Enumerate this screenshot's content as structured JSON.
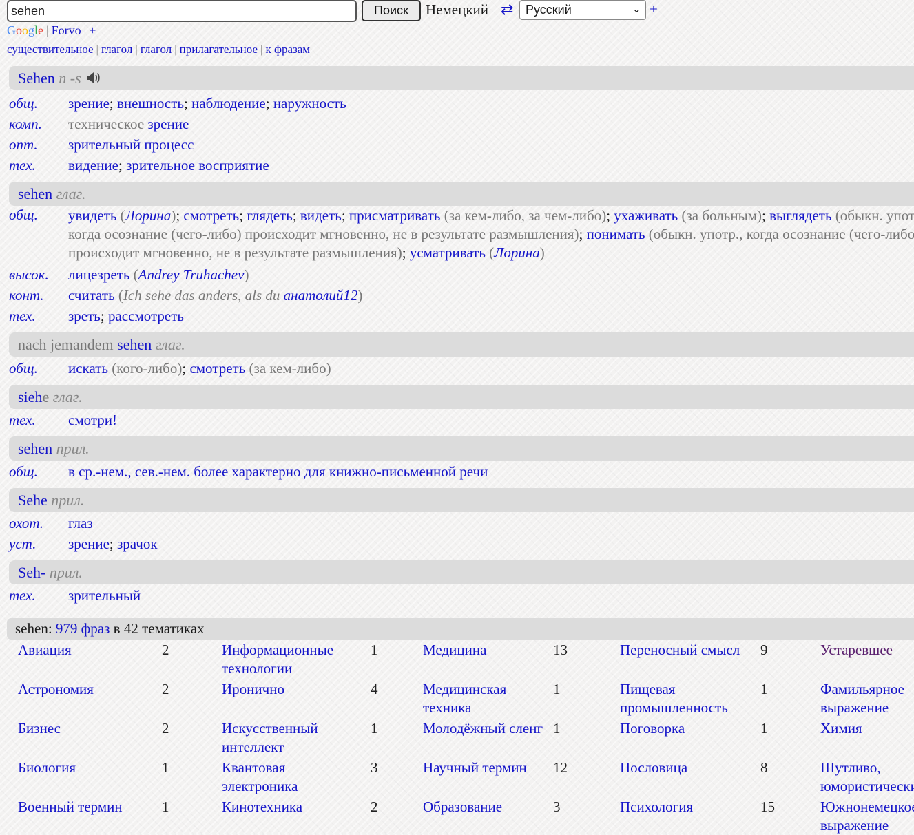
{
  "search": {
    "value": "sehen",
    "button_label": "Поиск"
  },
  "lang": {
    "source": "Немецкий",
    "swap_glyph": "⇄",
    "target": "Русский",
    "add": "+"
  },
  "top_links": {
    "google": [
      "G",
      "o",
      "o",
      "g",
      "l",
      "e"
    ],
    "forvo": "Forvo",
    "plus": "+"
  },
  "pos_links": [
    "существительное",
    "глагол",
    "глагол",
    "прилагательное",
    "к фразам"
  ],
  "entries": [
    {
      "word": "Sehen",
      "gram": "n -s",
      "has_audio": true,
      "rows": [
        {
          "subj": "общ.",
          "html": "a:зрение|; |a:внешность|; |a:наблюдение|; |a:наружность"
        },
        {
          "subj": "комп.",
          "html": "g:техническое |a:зрение"
        },
        {
          "subj": "опт.",
          "html": "a:зрительный процесс"
        },
        {
          "subj": "тех.",
          "html": "a:видение|; |a:зрительное восприятие"
        }
      ]
    },
    {
      "word": "sehen",
      "gram": "глаг.",
      "rows": [
        {
          "subj": "общ.",
          "wrap": true,
          "html": "a:увидеть| |g:(|ai:Лорина|g:)|; |a:смотреть|; |a:глядеть|; |a:видеть|; |a:присматривать| |g:(за кем-либо, за чем-либо)|; |a:ухаживать| |g:(за больным)|; |a:выглядеть| |g:(обыкн. употр., когда осознание (чего-либо) происходит мгновенно, не в результате размышления)|; |a:понимать| |g:(обыкн. употр., когда осознание (чего-либо) происходит мгновенно, не в результате размышления)|; |a:усматривать| |g:(|ai:Лорина|g:)"
        },
        {
          "subj": "высок.",
          "html": "a:лицезреть| |g:(|ai:Andrey Truhachev|g:)"
        },
        {
          "subj": "конт.",
          "html": "a:считать| |g:(|gi:Ich sehe das anders, als du |ai:анатолий12|g:)"
        },
        {
          "subj": "тех.",
          "html": "a:зреть|; |a:рассмотреть"
        }
      ]
    },
    {
      "word_parts": [
        [
          "g",
          "nach jemandem "
        ],
        [
          "a",
          "sehen"
        ]
      ],
      "gram": "глаг.",
      "rows": [
        {
          "subj": "общ.",
          "html": "a:искать| |g:(кого-либо)|; |a:смотреть| |g:(за кем-либо)"
        }
      ]
    },
    {
      "word_parts": [
        [
          "a",
          "sieh"
        ],
        [
          "g",
          "e"
        ]
      ],
      "gram": "глаг.",
      "rows": [
        {
          "subj": "тех.",
          "html": "a:смотри!"
        }
      ]
    },
    {
      "word": "sehen",
      "gram": "прил.",
      "rows": [
        {
          "subj": "общ.",
          "html": "a:в ср.-нем., сев.-нем. более характерно для книжно-письменной речи"
        }
      ]
    },
    {
      "word": "Sehe",
      "gram": "прил.",
      "rows": [
        {
          "subj": "охот.",
          "html": "a:глаз"
        },
        {
          "subj": "уст.",
          "html": "a:зрение|; |a:зрачок"
        }
      ]
    },
    {
      "word": "Seh-",
      "gram": "прил.",
      "rows": [
        {
          "subj": "тех.",
          "html": "a:зрительный"
        }
      ]
    }
  ],
  "phrases": {
    "word": "sehen",
    "count_link": "979 фраз",
    "tail": "в 42 тематиках",
    "columns": [
      [
        [
          "Авиация",
          "2"
        ],
        [
          "Астрономия",
          "2"
        ],
        [
          "Бизнес",
          "2"
        ],
        [
          "Биология",
          "1"
        ],
        [
          "Военный термин",
          "1"
        ]
      ],
      [
        [
          "Информационные технологии",
          "1"
        ],
        [
          "Иронично",
          "4"
        ],
        [
          "Искусственный интеллект",
          "1"
        ],
        [
          "Квантовая электроника",
          "3"
        ],
        [
          "Кинотехника",
          "2"
        ]
      ],
      [
        [
          "Медицина",
          "13"
        ],
        [
          "Медицинская техника",
          "1"
        ],
        [
          "Молодёжный сленг",
          "1"
        ],
        [
          "Научный термин",
          "12"
        ],
        [
          "Образование",
          "3"
        ]
      ],
      [
        [
          "Переносный смысл",
          "9"
        ],
        [
          "Пищевая промышленность",
          "1"
        ],
        [
          "Поговорка",
          "1"
        ],
        [
          "Пословица",
          "8"
        ],
        [
          "Психология",
          "15"
        ]
      ],
      [
        [
          "Устаревшее",
          ""
        ],
        [
          "Фамильярное выражение",
          ""
        ],
        [
          "Химия",
          ""
        ],
        [
          "Шутливо, юмористически",
          ""
        ],
        [
          "Южнонемецкое выражение",
          ""
        ]
      ]
    ]
  }
}
